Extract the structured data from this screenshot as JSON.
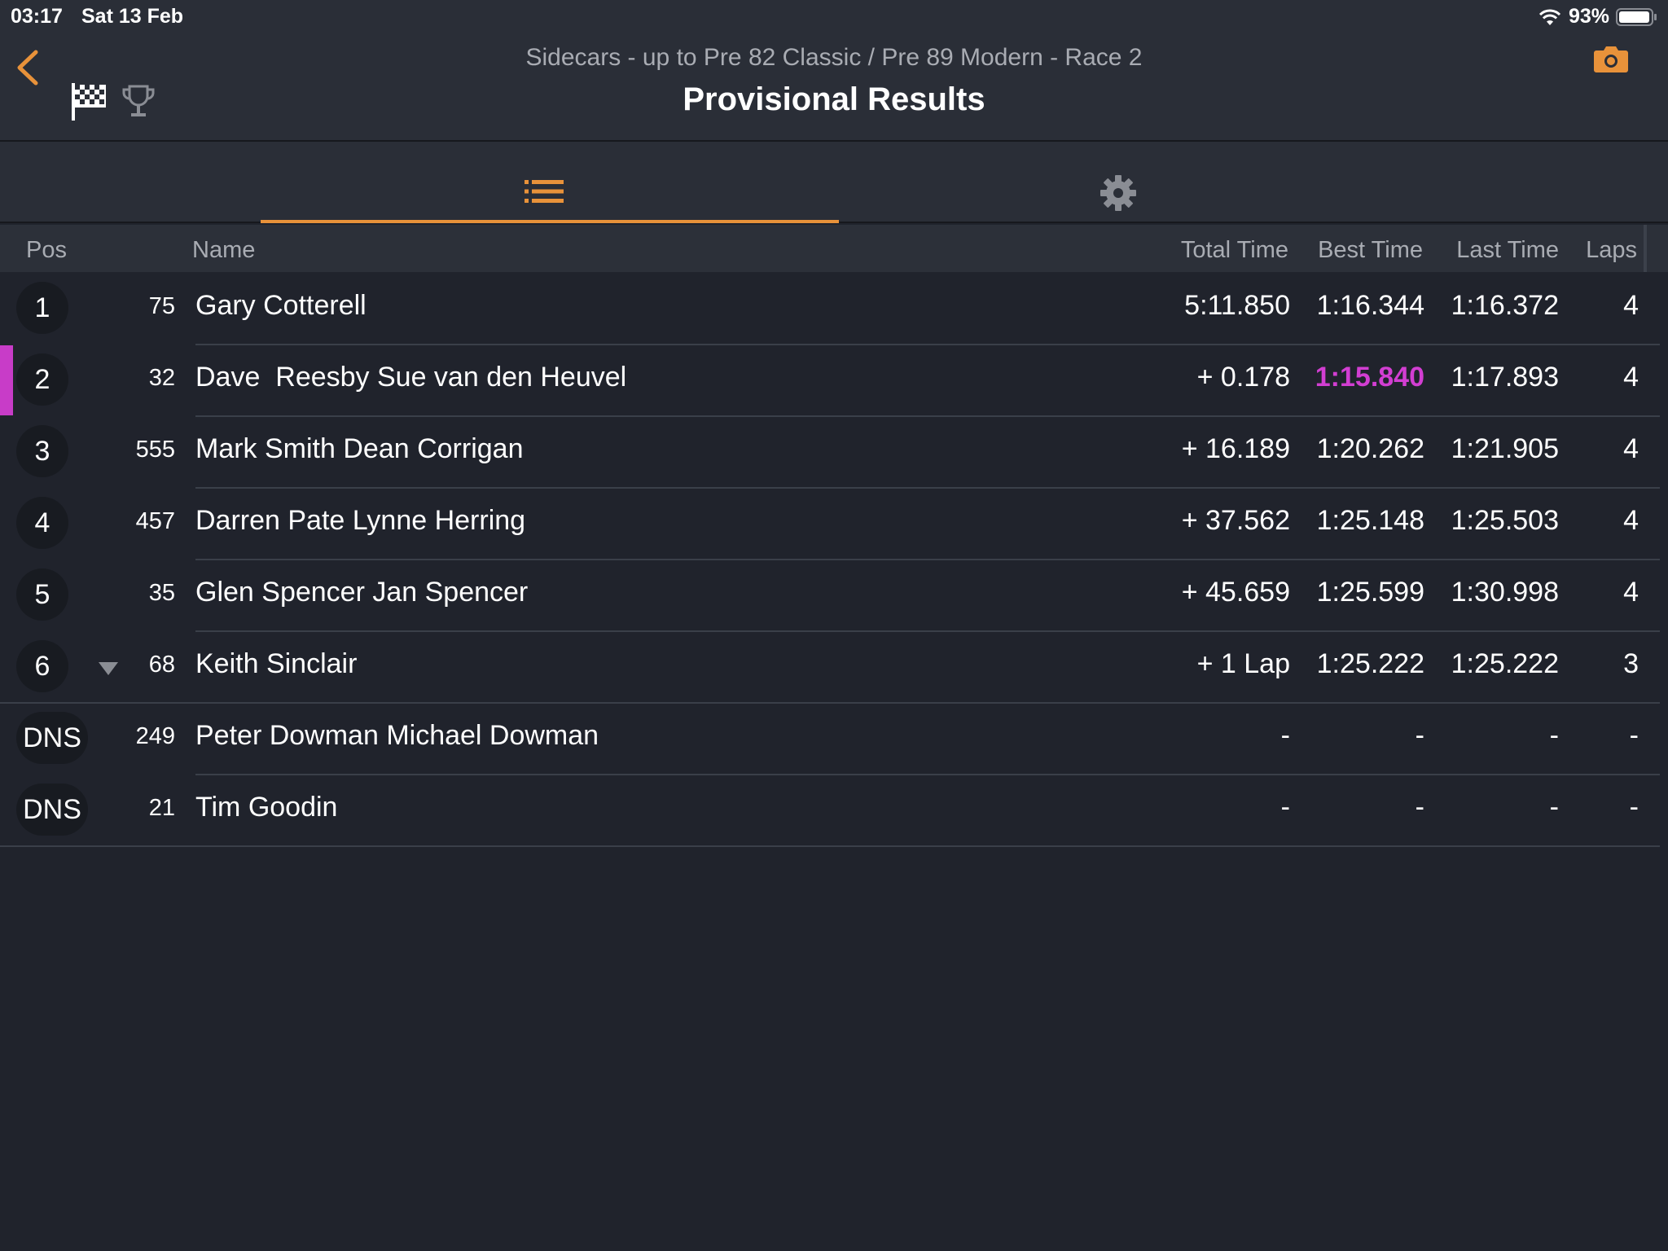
{
  "status_bar": {
    "time": "03:17",
    "date": "Sat 13 Feb",
    "battery": "93%"
  },
  "header": {
    "subtitle": "Sidecars - up to Pre 82 Classic / Pre 89 Modern - Race 2",
    "title": "Provisional Results"
  },
  "tabs": [
    {
      "icon": "list-icon",
      "active": true
    },
    {
      "icon": "gear-icon",
      "active": false
    }
  ],
  "columns": {
    "pos": "Pos",
    "name": "Name",
    "total": "Total Time",
    "best": "Best Time",
    "last": "Last Time",
    "laps": "Laps"
  },
  "colors": {
    "accent": "#e8923a",
    "fastest": "#d23ed2",
    "background": "#20232c"
  },
  "rows": [
    {
      "pos": "1",
      "num": "75",
      "name": "Gary Cotterell",
      "total": "5:11.850",
      "best": "1:16.344",
      "last": "1:16.372",
      "laps": "4"
    },
    {
      "pos": "2",
      "num": "32",
      "name": "Dave  Reesby Sue van den Heuvel",
      "total": "+ 0.178",
      "best": "1:15.840",
      "last": "1:17.893",
      "laps": "4",
      "fastest": true
    },
    {
      "pos": "3",
      "num": "555",
      "name": "Mark Smith Dean Corrigan",
      "total": "+ 16.189",
      "best": "1:20.262",
      "last": "1:21.905",
      "laps": "4"
    },
    {
      "pos": "4",
      "num": "457",
      "name": "Darren Pate Lynne Herring",
      "total": "+ 37.562",
      "best": "1:25.148",
      "last": "1:25.503",
      "laps": "4"
    },
    {
      "pos": "5",
      "num": "35",
      "name": "Glen Spencer Jan Spencer",
      "total": "+ 45.659",
      "best": "1:25.599",
      "last": "1:30.998",
      "laps": "4"
    },
    {
      "pos": "6",
      "num": "68",
      "name": "Keith Sinclair",
      "total": "+ 1 Lap",
      "best": "1:25.222",
      "last": "1:25.222",
      "laps": "3",
      "change": "down"
    },
    {
      "pos": "DNS",
      "num": "249",
      "name": "Peter Dowman Michael Dowman",
      "total": "-",
      "best": "-",
      "last": "-",
      "laps": "-"
    },
    {
      "pos": "DNS",
      "num": "21",
      "name": "Tim Goodin",
      "total": "-",
      "best": "-",
      "last": "-",
      "laps": "-"
    }
  ]
}
